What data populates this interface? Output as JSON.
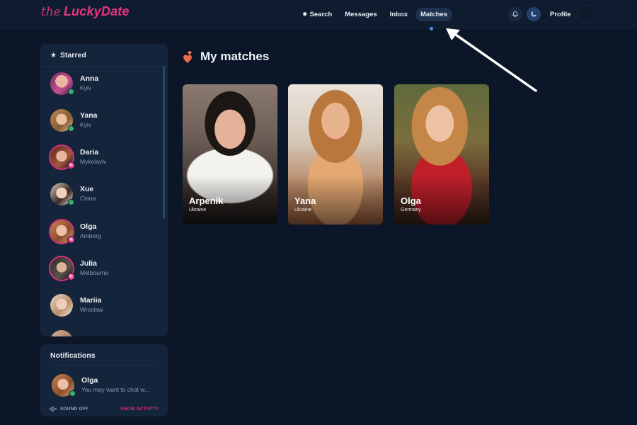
{
  "header": {
    "logo_prefix": "the",
    "logo_main": "LuckyDate",
    "nav": [
      {
        "label": "Search",
        "icon": "gear-icon"
      },
      {
        "label": "Messages"
      },
      {
        "label": "Inbox"
      },
      {
        "label": "Matches",
        "active": true
      }
    ],
    "profile_label": "Profile"
  },
  "starred": {
    "title": "Starred",
    "contacts": [
      {
        "name": "Anna",
        "city": "Kyiv",
        "status": "online"
      },
      {
        "name": "Yana",
        "city": "Kyiv",
        "status": "online"
      },
      {
        "name": "Daria",
        "city": "Mykolayiv",
        "status": "new"
      },
      {
        "name": "Xue",
        "city": "China",
        "status": "online"
      },
      {
        "name": "Olga",
        "city": "Amberg",
        "status": "new"
      },
      {
        "name": "Julia",
        "city": "Melbourne",
        "status": "new"
      },
      {
        "name": "Mariia",
        "city": "Wroclaw",
        "status": "none"
      }
    ]
  },
  "notifications": {
    "title": "Notifications",
    "item": {
      "name": "Olga",
      "message": "You may want to chat w..."
    },
    "sound_off": "SOUND OFF",
    "show_activity": "SHOW ACTIVITY"
  },
  "main": {
    "title": "My matches",
    "matches": [
      {
        "name": "Arpenik",
        "country": "Ukraine"
      },
      {
        "name": "Yana",
        "country": "Ukraine"
      },
      {
        "name": "Olga",
        "country": "Germany"
      }
    ]
  },
  "colors": {
    "background": "#0b1628",
    "panel": "#14243a",
    "brand": "#e8337f",
    "online": "#35b26b",
    "active_nav": "#1f3150"
  }
}
